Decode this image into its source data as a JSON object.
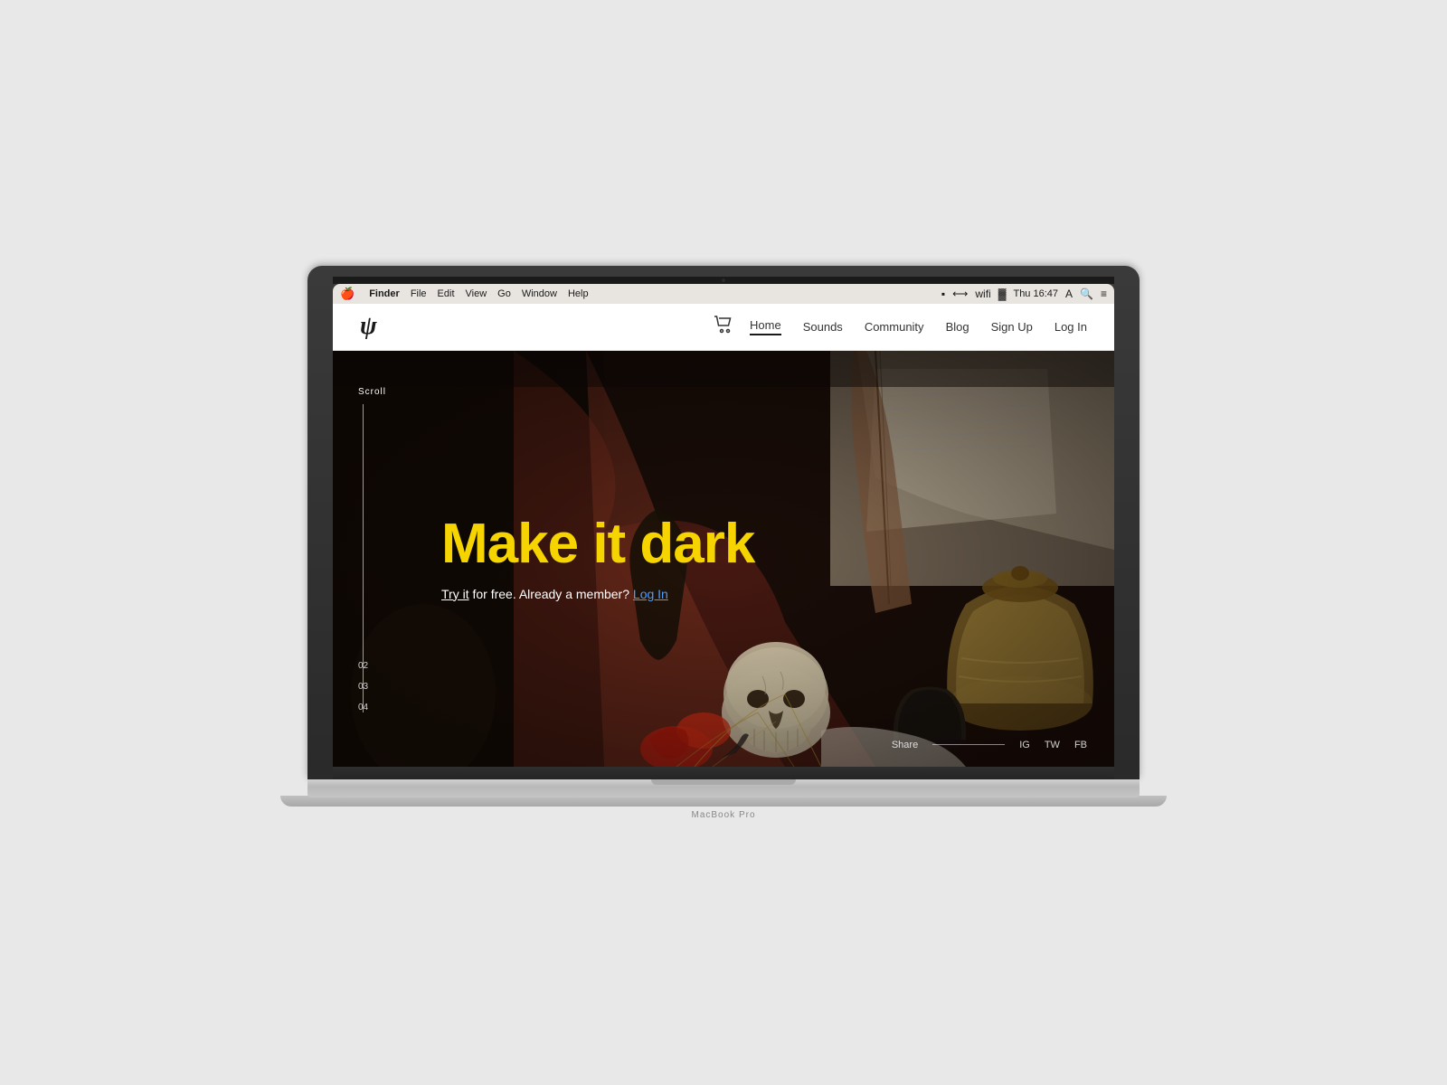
{
  "macbook": {
    "label": "MacBook Pro"
  },
  "menubar": {
    "apple": "🍎",
    "app_name": "Finder",
    "items": [
      "File",
      "Edit",
      "View",
      "Go",
      "Window",
      "Help"
    ],
    "time": "Thu 16:47",
    "icons": [
      "⊞",
      "↔",
      "wifi",
      "batt"
    ]
  },
  "site": {
    "logo": "ψ",
    "cart_icon": "🛒",
    "nav": {
      "items": [
        {
          "label": "Home",
          "active": true
        },
        {
          "label": "Sounds",
          "active": false
        },
        {
          "label": "Community",
          "active": false
        },
        {
          "label": "Blog",
          "active": false
        },
        {
          "label": "Sign Up",
          "active": false
        },
        {
          "label": "Log In",
          "active": false
        }
      ]
    },
    "hero": {
      "headline": "Make it dark",
      "subline_prefix": "",
      "try_text": "Try it",
      "subline_middle": " for free. Already a member?",
      "login_text": "Log In",
      "scroll_label": "Scroll",
      "scroll_numbers": [
        "02",
        "03",
        "04"
      ],
      "share_label": "Share",
      "share_links": [
        "IG",
        "TW",
        "FB"
      ]
    }
  }
}
